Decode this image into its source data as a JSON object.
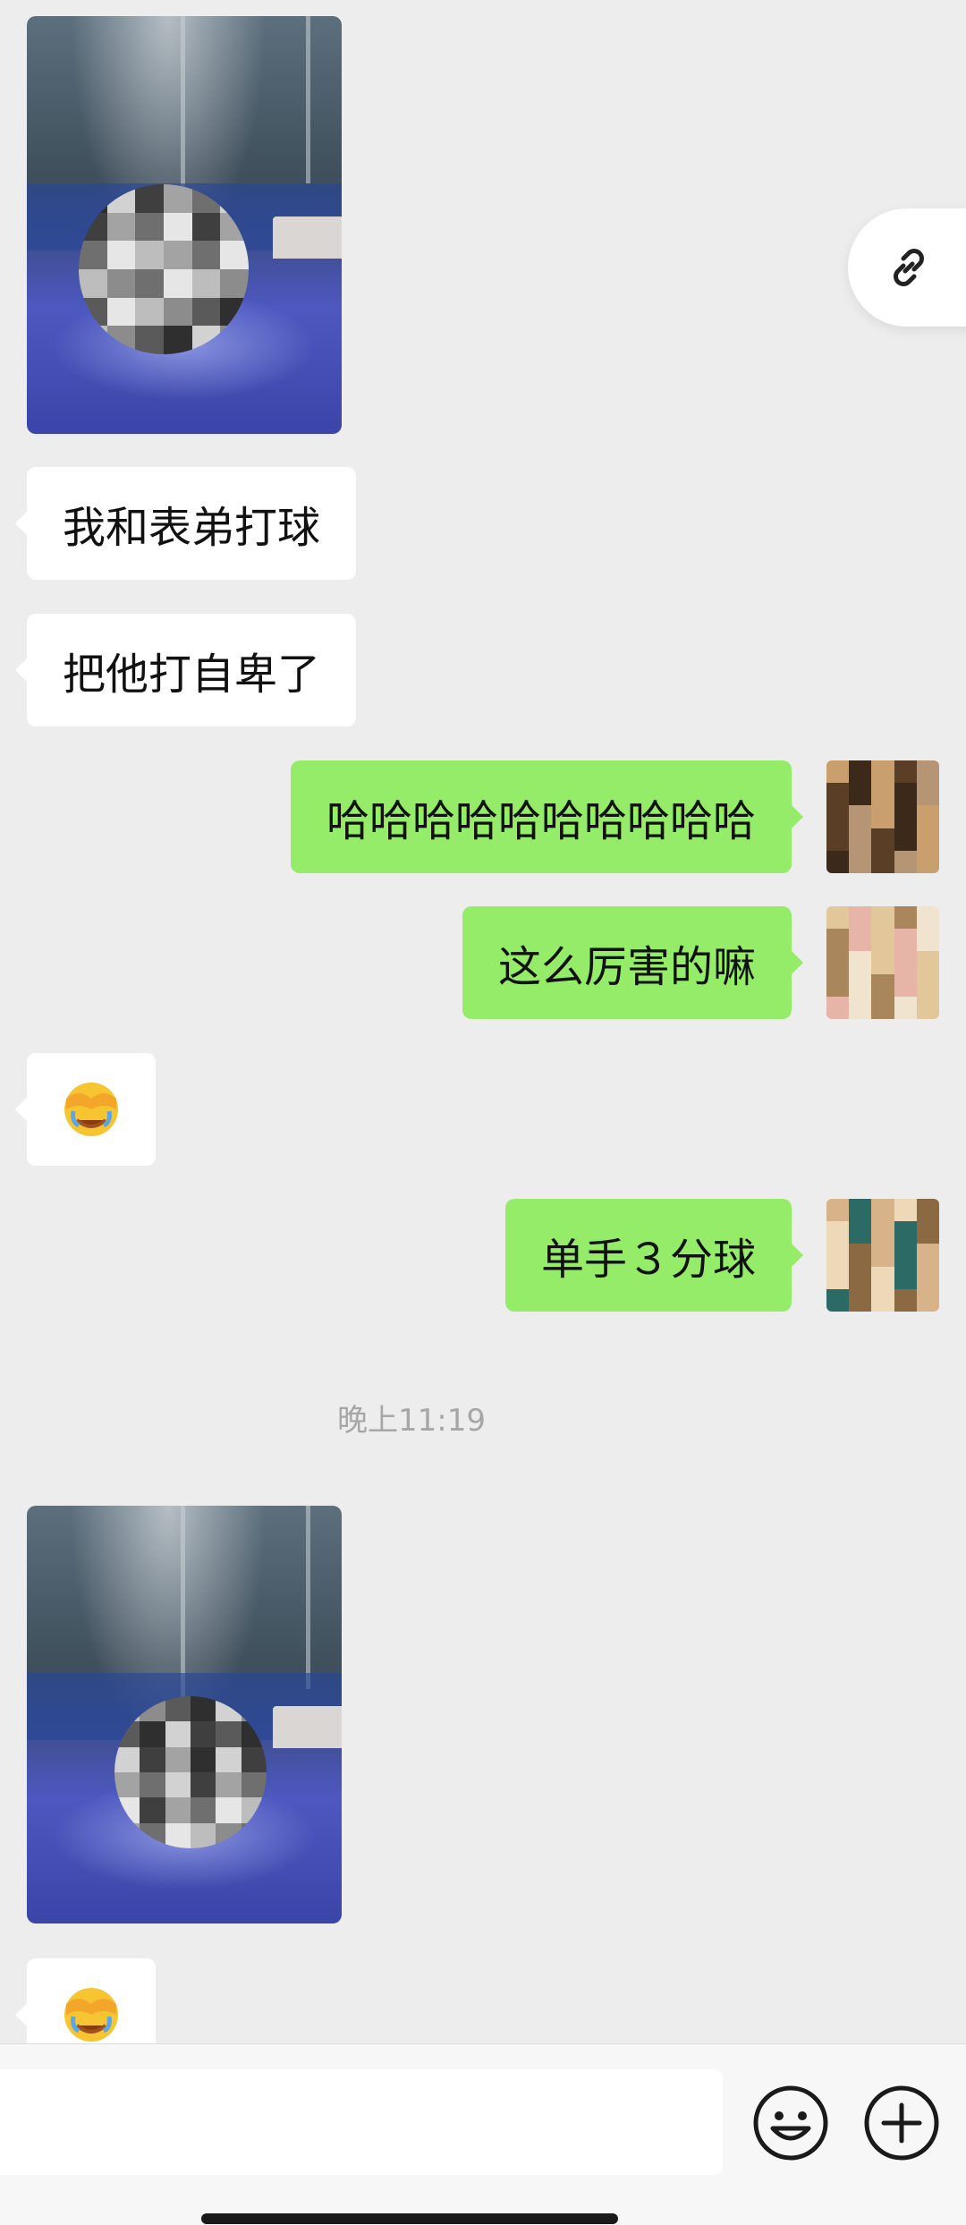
{
  "messages": {
    "left_text_1": "我和表弟打球",
    "left_text_2": "把他打自卑了",
    "right_text_1": "哈哈哈哈哈哈哈哈哈哈",
    "right_text_2": "这么厉害的嘛",
    "right_text_3": "单手３分球"
  },
  "timestamp": "晚上11:19",
  "icons": {
    "link": "link-icon",
    "emoji_button": "smiley-icon",
    "plus_button": "plus-circle-icon",
    "sticker": "face-with-hand-over-eyes-emoji"
  },
  "colors": {
    "background": "#ededed",
    "sent_bubble": "#95ec69",
    "received_bubble": "#ffffff"
  }
}
